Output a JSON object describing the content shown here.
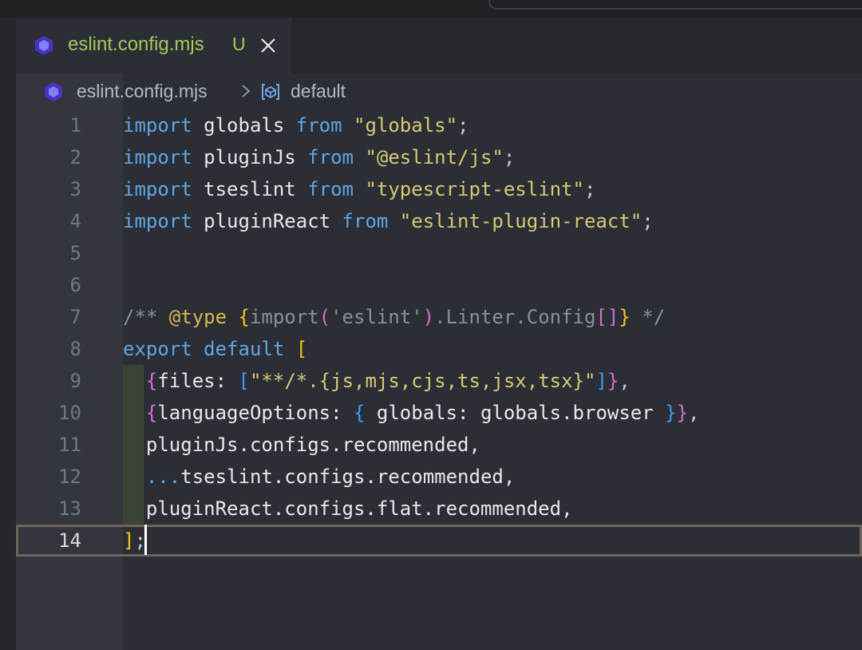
{
  "tab": {
    "title": "eslint.config.mjs",
    "status": "U"
  },
  "breadcrumb": {
    "file": "eslint.config.mjs",
    "symbol": "default"
  },
  "colors": {
    "keyword": "#5ea5e6",
    "string": "#d9c774",
    "comment": "#8a8f98",
    "bracket_yellow": "#f5c518",
    "bracket_purple": "#d66bd3",
    "bracket_blue": "#3f9af5",
    "tab_title": "#a4c75a"
  },
  "icons": {
    "tab": "eslint-icon",
    "close": "close-icon",
    "breadcrumb_file": "eslint-icon",
    "breadcrumb_symbol": "symbol-namespace-icon"
  },
  "editor": {
    "current_line": 14,
    "lines": [
      {
        "num": "1",
        "tokens": [
          [
            "kw",
            "import"
          ],
          [
            "ident",
            " globals "
          ],
          [
            "kw",
            "from"
          ],
          [
            "ident",
            " "
          ],
          [
            "str",
            "\"globals\""
          ],
          [
            "punct",
            ";"
          ]
        ]
      },
      {
        "num": "2",
        "tokens": [
          [
            "kw",
            "import"
          ],
          [
            "ident",
            " pluginJs "
          ],
          [
            "kw",
            "from"
          ],
          [
            "ident",
            " "
          ],
          [
            "str",
            "\"@eslint/js\""
          ],
          [
            "punct",
            ";"
          ]
        ]
      },
      {
        "num": "3",
        "tokens": [
          [
            "kw",
            "import"
          ],
          [
            "ident",
            " tseslint "
          ],
          [
            "kw",
            "from"
          ],
          [
            "ident",
            " "
          ],
          [
            "str",
            "\"typescript-eslint\""
          ],
          [
            "punct",
            ";"
          ]
        ]
      },
      {
        "num": "4",
        "tokens": [
          [
            "kw",
            "import"
          ],
          [
            "ident",
            " pluginReact "
          ],
          [
            "kw",
            "from"
          ],
          [
            "ident",
            " "
          ],
          [
            "str",
            "\"eslint-plugin-react\""
          ],
          [
            "punct",
            ";"
          ]
        ]
      },
      {
        "num": "5",
        "tokens": []
      },
      {
        "num": "6",
        "tokens": []
      },
      {
        "num": "7",
        "tokens": [
          [
            "cm",
            "/** "
          ],
          [
            "cmtag",
            "@type"
          ],
          [
            "cm",
            " "
          ],
          [
            "brY",
            "{"
          ],
          [
            "cm",
            "import"
          ],
          [
            "brP",
            "("
          ],
          [
            "cm",
            "'eslint'"
          ],
          [
            "brP",
            ")"
          ],
          [
            "cm",
            ".Linter.Config"
          ],
          [
            "brP",
            "["
          ],
          [
            "brP",
            "]"
          ],
          [
            "brY",
            "}"
          ],
          [
            "cm",
            " */"
          ]
        ]
      },
      {
        "num": "8",
        "tokens": [
          [
            "kw",
            "export"
          ],
          [
            "ident",
            " "
          ],
          [
            "kw",
            "default"
          ],
          [
            "ident",
            " "
          ],
          [
            "brY",
            "["
          ]
        ]
      },
      {
        "num": "9",
        "tokens": [
          [
            "ident",
            "  "
          ],
          [
            "brP",
            "{"
          ],
          [
            "ident",
            "files: "
          ],
          [
            "brB",
            "["
          ],
          [
            "str",
            "\"**/*.{js,mjs,cjs,ts,jsx,tsx}\""
          ],
          [
            "brB",
            "]"
          ],
          [
            "brP",
            "}"
          ],
          [
            "punct",
            ","
          ]
        ]
      },
      {
        "num": "10",
        "tokens": [
          [
            "ident",
            "  "
          ],
          [
            "brP",
            "{"
          ],
          [
            "ident",
            "languageOptions: "
          ],
          [
            "brB",
            "{"
          ],
          [
            "ident",
            " globals: globals.browser "
          ],
          [
            "brB",
            "}"
          ],
          [
            "brP",
            "}"
          ],
          [
            "punct",
            ","
          ]
        ]
      },
      {
        "num": "11",
        "tokens": [
          [
            "ident",
            "  pluginJs.configs.recommended,"
          ]
        ]
      },
      {
        "num": "12",
        "tokens": [
          [
            "ident",
            "  "
          ],
          [
            "kw",
            "..."
          ],
          [
            "ident",
            "tseslint.configs.recommended,"
          ]
        ]
      },
      {
        "num": "13",
        "tokens": [
          [
            "ident",
            "  pluginReact.configs.flat.recommended,"
          ]
        ]
      },
      {
        "num": "14",
        "tokens": [
          [
            "brY",
            "]"
          ],
          [
            "punct",
            ";"
          ]
        ]
      }
    ]
  }
}
